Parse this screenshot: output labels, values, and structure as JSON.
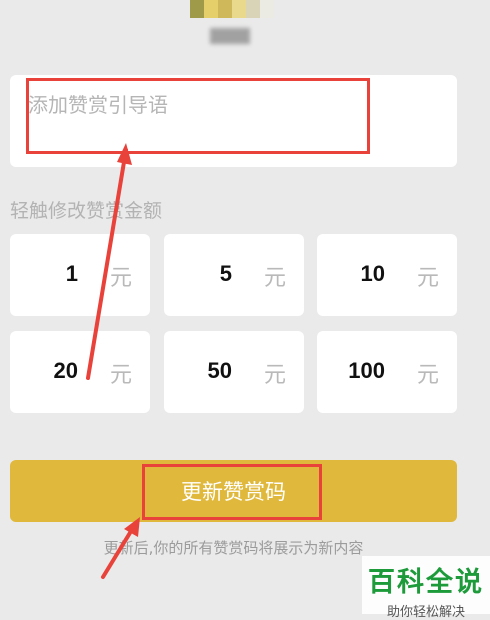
{
  "reward": {
    "guide_placeholder": "添加赞赏引导语",
    "amount_label": "轻触修改赞赏金额",
    "amounts": [
      {
        "value": "1",
        "unit": "元"
      },
      {
        "value": "5",
        "unit": "元"
      },
      {
        "value": "10",
        "unit": "元"
      },
      {
        "value": "20",
        "unit": "元"
      },
      {
        "value": "50",
        "unit": "元"
      },
      {
        "value": "100",
        "unit": "元"
      }
    ],
    "update_button": "更新赞赏码",
    "hint": "更新后,你的所有赞赏码将展示为新内容"
  },
  "watermark": {
    "title": "百科全说",
    "subtitle": "助你轻松解决"
  },
  "colors": {
    "button": "#dfb83c",
    "annotation": "#e8423b",
    "background": "#eaeaea"
  }
}
